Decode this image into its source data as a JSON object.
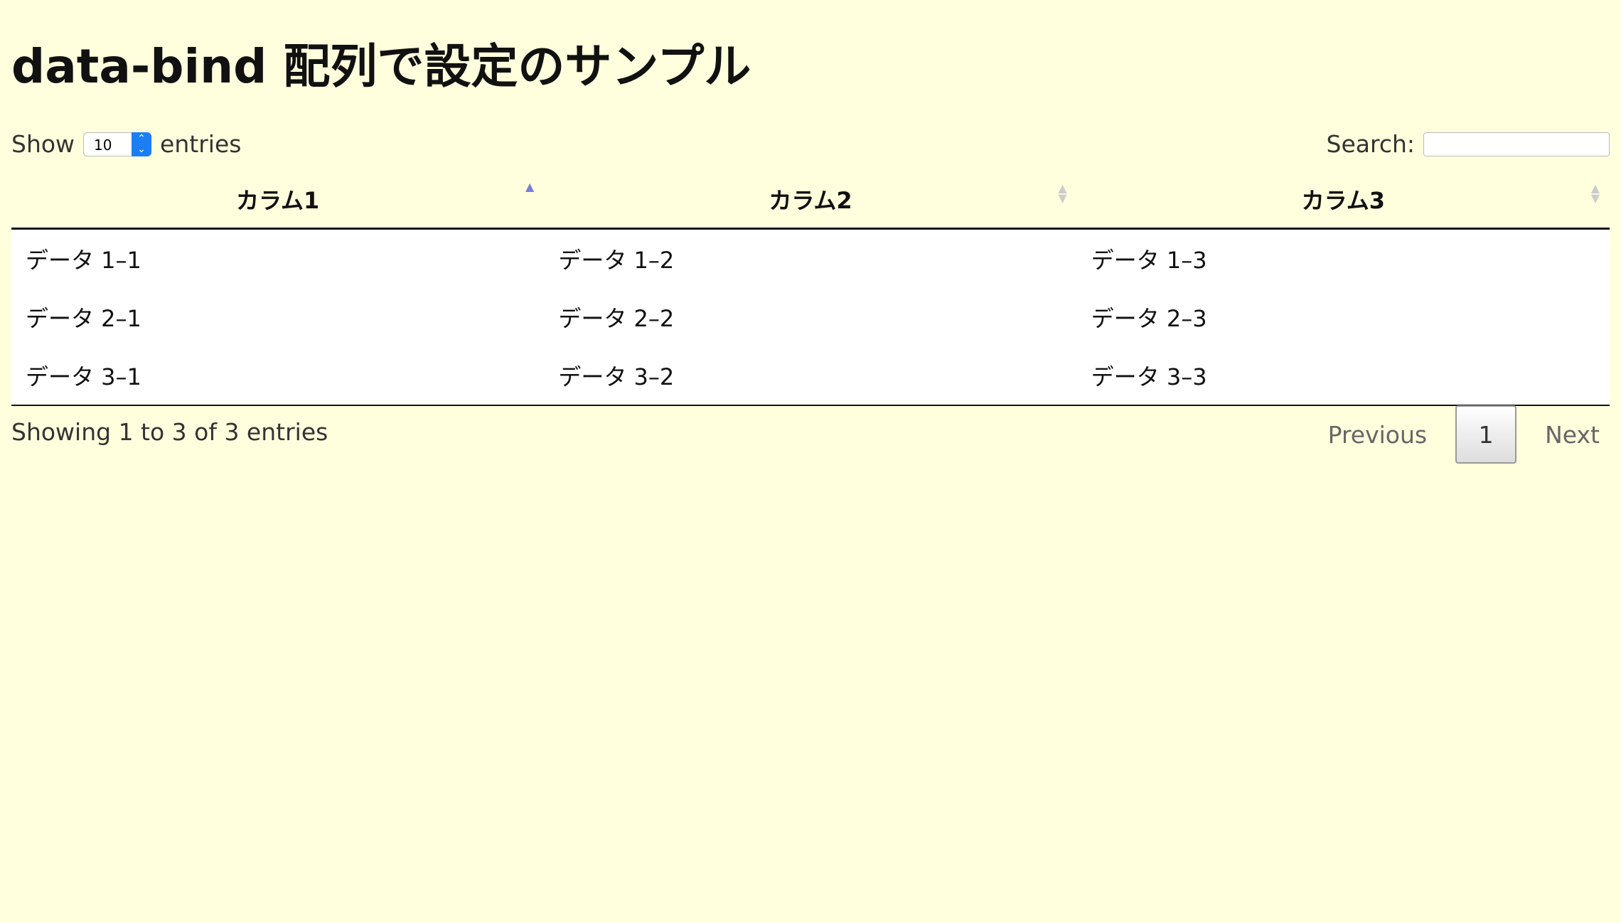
{
  "title": "data-bind 配列で設定のサンプル",
  "length": {
    "show_label": "Show",
    "value": "10",
    "entries_label": "entries"
  },
  "search": {
    "label": "Search:",
    "value": ""
  },
  "table": {
    "columns": [
      "カラム1",
      "カラム2",
      "カラム3"
    ],
    "sort": {
      "column": 0,
      "direction": "ascending"
    },
    "rows": [
      [
        "データ 1–1",
        "データ 1–2",
        "データ 1–3"
      ],
      [
        "データ 2–1",
        "データ 2–2",
        "データ 2–3"
      ],
      [
        "データ 3–1",
        "データ 3–2",
        "データ 3–3"
      ]
    ]
  },
  "info": "Showing 1 to 3 of 3 entries",
  "pagination": {
    "previous": "Previous",
    "current": "1",
    "next": "Next"
  },
  "colors": {
    "background": "#ffffdd",
    "sort_active": "#7a7fd8",
    "select_accent": "#1a7ff5"
  }
}
